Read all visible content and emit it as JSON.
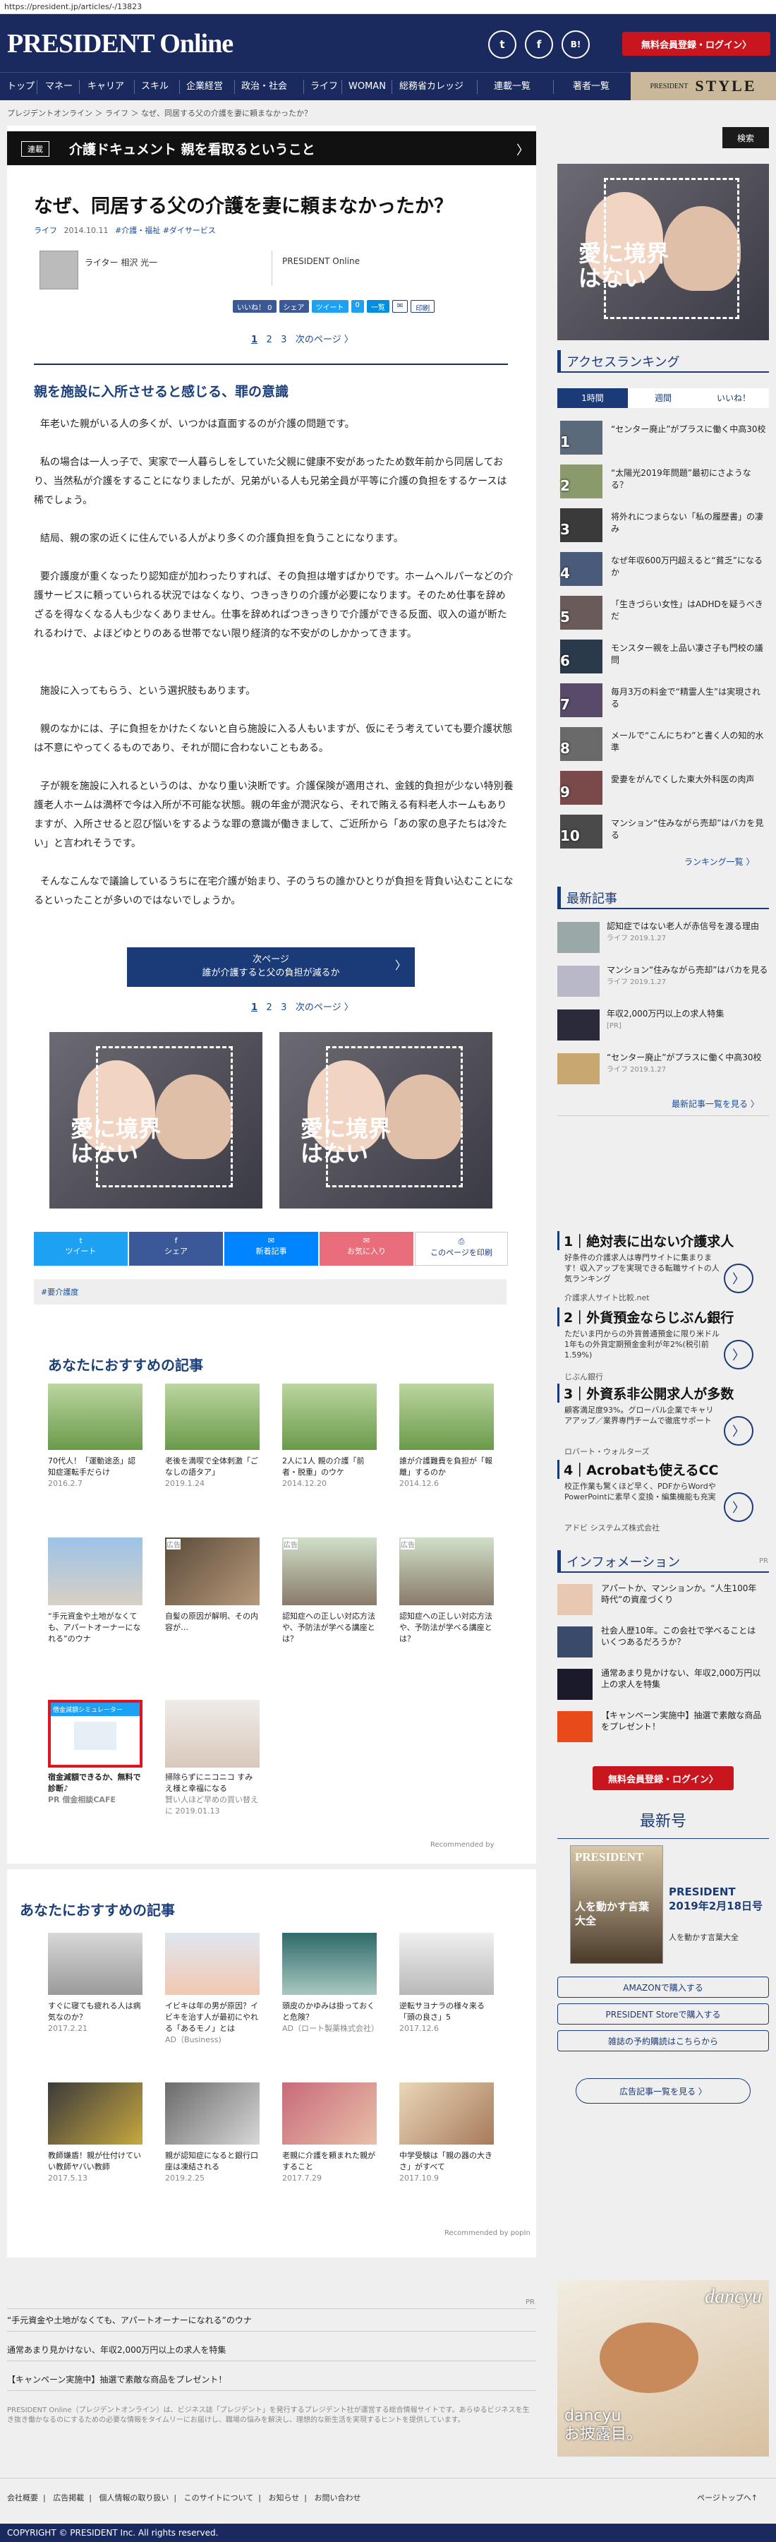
{
  "url": "https://president.jp/articles/-/13823",
  "header": {
    "logo": "PRESIDENT Online",
    "social": [
      "t",
      "f",
      "B!"
    ],
    "register": "無料会員登録・ログイン〉"
  },
  "nav": {
    "items": [
      "トップ",
      "マネー",
      "キャリア",
      "スキル",
      "企業経営",
      "政治・社会",
      "ライフ",
      "WOMAN",
      "総務省カレッジ",
      "連載一覧",
      "著者一覧"
    ],
    "style_logo": "STYLE",
    "style_sub": "PRESIDENT"
  },
  "breadcrumb": "プレジデントオンライン ＞ ライフ ＞ なぜ、同居する父の介護を妻に頼まなかったか？",
  "series": {
    "tag": "連載",
    "title": "介護ドキュメント 親を看取るということ",
    "arrow": "〉"
  },
  "article": {
    "title": "なぜ、同居する父の介護を妻に頼まなかったか？",
    "category": "ライフ",
    "date": "2014.10.11",
    "tags": "#介護・福祉 #ダイサービス",
    "author": "ライター 相沢 光一",
    "publisher": "PRESIDENT Online",
    "share": [
      "いいね！ 0",
      "シェア",
      "ツイート",
      "0",
      "一覧",
      "印刷"
    ],
    "pager": [
      "1",
      "2",
      "3",
      "次のページ 〉"
    ],
    "section_heading": "親を施設に入所させると感じる、罪の意識",
    "paragraphs": [
      "年老いた親がいる人の多くが、いつかは直面するのが介護の問題です。",
      "私の場合は一人っ子で、実家で一人暮らしをしていた父親に健康不安があったため数年前から同居しており、当然私が介護をすることになりましたが、兄弟がいる人も兄弟全員が平等に介護の負担をするケースは稀でしょう。",
      "結局、親の家の近くに住んでいる人がより多くの介護負担を負うことになります。",
      "要介護度が重くなったり認知症が加わったりすれば、その負担は増すばかりです。ホームヘルパーなどの介護サービスに頼っていられる状況ではなくなり、つきっきりの介護が必要になります。そのため仕事を辞めざるを得なくなる人も少なくありません。仕事を辞めればつきっきりで介護ができる反面、収入の道が断たれるわけで、よほどゆとりのある世帯でない限り経済的な不安がのしかかってきます。",
      "施設に入ってもらう、という選択肢もあります。",
      "親のなかには、子に負担をかけたくないと自ら施設に入る人もいますが、仮にそう考えていても要介護状態は不意にやってくるものであり、それが間に合わないこともある。",
      "子が親を施設に入れるというのは、かなり重い決断です。介護保険が適用され、金銭的負担が少ない特別養護老人ホームは満杯で今は入所が不可能な状態。親の年金が潤沢なら、それで賄える有料老人ホームもありますが、入所させると忍び悩いをするような罪の意識が働きまして、ご近所から「あの家の息子たちは冷たい」と言われそうです。",
      "そんなこんなで議論しているうちに在宅介護が始まり、子のうちの誰かひとりが負担を背負い込むことになるといったことが多いのではないでしょうか。"
    ],
    "next_button": [
      "次ページ",
      "誰が介護すると父の負担が減るか"
    ],
    "ad_text": "愛に境界はない",
    "bottom_share": [
      "ツイート",
      "シェア",
      "新着記事",
      "お気に入り",
      "このページを印刷"
    ],
    "tag_box": "#要介護度"
  },
  "recommend1": {
    "title": "あなたにおすすめの記事",
    "row1": [
      {
        "title": "70代人！「運動途丞」認知症運転手だらけ",
        "date": "2016.2.7"
      },
      {
        "title": "老後を満喫で全体刺激「ごなしの語タア」",
        "date": "2019.1.24"
      },
      {
        "title": "2人に1人 親の介護「前者・脱重」のウケ",
        "date": "2014.12.20"
      },
      {
        "title": "誰が介護難費を負担が「報離」するのか",
        "date": "2014.12.6"
      }
    ],
    "row2": [
      {
        "title": "“手元資金や土地がなくても、アパートオーナーになれる”のウナ",
        "label": ""
      },
      {
        "title": "自髪の原因が解明、その内容が…",
        "label": "広告"
      },
      {
        "title": "認知症への正しい対応方法や、予防法が学べる講座とは？",
        "label": "広告"
      },
      {
        "title": "認知症への正しい対応方法や、予防法が学べる講座とは？",
        "label": "広告"
      }
    ],
    "row3": [
      {
        "title": "宿金減額できるか、無料で診断♪",
        "sub": "PR 借金相談CAFE",
        "box": "借金減額シミュレーター"
      },
      {
        "title": "掃除らずにニコニコ すみえ様と幸福になる",
        "sub": "賢い人ほど早めの買い替えに 2019.01.13",
        "box": ""
      }
    ],
    "credit": "Recommended by"
  },
  "recommend2": {
    "title": "あなたにおすすめの記事",
    "row1": [
      {
        "title": "すぐに寝ても疲れる人は病気なのか？",
        "date": "2017.2.21"
      },
      {
        "title": "イビキは年の男が原因？イビキを治す人が最初にやれる「あるモノ」とは",
        "date": "AD（Business)"
      },
      {
        "title": "頭皮のかゆみは掛っておくと危険？",
        "date": "AD（ロート製薬株式会社）"
      },
      {
        "title": "逆転サヨナラの様々来る「頭の良さ」5",
        "date": "2017.12.6"
      }
    ],
    "row2": [
      {
        "title": "教師嫌盾！親が仕付けていい教師ヤバい教師",
        "date": "2017.5.13"
      },
      {
        "title": "親が認知症になると銀行口座は凍結される",
        "date": "2019.2.25"
      },
      {
        "title": "老親に介護を頼まれた親がすること",
        "date": "2017.7.29"
      },
      {
        "title": "中学受験は「親の器の大きさ」がすべて",
        "date": "2017.10.9"
      }
    ],
    "credit": "Recommended by popIn"
  },
  "lower_links": [
    "“手元資金や土地がなくても、アパートオーナーになれる”のウナ",
    "通常あまり見かけない、年収2,000万円以上の求人を特集",
    "【キャンペーン実施中】抽選で素敵な商品をプレゼント！"
  ],
  "pr_label": "PR",
  "about": "PRESIDENT Online（プレジデントオンライン）は、ビジネス誌「プレジデント」を発行するプレジデント社が運営する総合情報サイトです。あらゆるビジネスを生き抜き働かなるのにするための必要な情報をタイムリーにお届けし、職場の悩みを解決し、理想的な新生活を実現するヒントを提供しています。",
  "footer": {
    "links": [
      "会社概要",
      "広告掲載",
      "個人情報の取り扱い",
      "このサイトについて",
      "お知らせ",
      "お問い合わせ"
    ],
    "top": "ページトップへ↑",
    "copyright": "COPYRIGHT © PRESIDENT Inc. All rights reserved."
  },
  "sidebar": {
    "search": "検索",
    "ranking_title": "アクセスランキング",
    "ranking_tabs": [
      "1時間",
      "週間",
      "いいね！"
    ],
    "ranking": [
      "“センター廃止”がプラスに働く中高30校",
      "“太陽光2019年問題”最初にさようなる？",
      "将外れにつまらない「私の履歴書」の凄み",
      "なぜ年収600万円超えると“貧乏”になるか",
      "「生きづらい女性」はADHDを疑うべきだ",
      "モンスター親を上品い凄さ子も門校の議問",
      "毎月3万の料金で“精霊人生”は実現される",
      "メールで“こんにちわ”と書く人の知的水準",
      "愛妻をがんでくした東大外科医の肉声",
      "マンション“住みながら売却”はバカを見る"
    ],
    "ranking_more": "ランキング一覧 〉",
    "latest_title": "最新記事",
    "latest": [
      {
        "title": "認知症ではない老人が赤信号を渡る理由",
        "meta": "ライフ 2019.1.27"
      },
      {
        "title": "マンション“住みながら売却”はバカを見る",
        "meta": "ライフ 2019.1.27"
      },
      {
        "title": "年収2,000万円以上の求人特集",
        "meta": "[PR]"
      },
      {
        "title": "“センター廃止”がプラスに働く中高30校",
        "meta": "ライフ 2019.1.27"
      }
    ],
    "latest_more": "最新記事一覧を見る 〉",
    "ads": [
      {
        "n": "1",
        "head": "絶対表に出ない介護求人",
        "body": "好条件の介護求人は専門サイトに集まります！収入アップを実現できる転職サイトの人気ランキング",
        "src": "介護求人サイト比較.net"
      },
      {
        "n": "2",
        "head": "外貨預金ならじぶん銀行",
        "body": "ただいま円からの外貨普通預金に限り米ドル1年もの外貨定期預金金利が年2%(税引前1.59%)",
        "src": "じぶん銀行"
      },
      {
        "n": "3",
        "head": "外資系非公開求人が多数",
        "body": "顧客満足度93%。グローバル企業でキャリアアップ／業界専門チームで徹底サポート",
        "src": "ロバート・ウォルターズ"
      },
      {
        "n": "4",
        "head": "Acrobatも使えるCC",
        "body": "校正作業も驚くほど早く、PDFからWordやPowerPointに素早く変換・編集機能も充実",
        "src": "アドビ システムズ株式会社"
      }
    ],
    "info_title": "インフォメーション",
    "info": [
      "アパートか、マンションか。“人生100年時代”の資産づくり",
      "社会人歴10年。この会社で学べることはいくつあるだろうか？",
      "通常あまり見かけない、年収2,000万円以上の求人を特集",
      "【キャンペーン実施中】抽選で素敵な商品をプレゼント！"
    ],
    "register2": "無料会員登録・ログイン〉",
    "latest_issue": "最新号",
    "magazine": {
      "name": "PRESIDENT",
      "date": "2019年2月18日号",
      "feature": "人を動かす言葉大全",
      "cover": "人を動かす言葉大全"
    },
    "buy_buttons": [
      "AMAZONで購入する",
      "PRESIDENT Storeで購入する",
      "雑誌の予約購読はこちらから"
    ],
    "ad_more": "広告記事一覧を見る 〉",
    "dancyu": "dancyu",
    "dancyu_sub": "お披露目。"
  }
}
